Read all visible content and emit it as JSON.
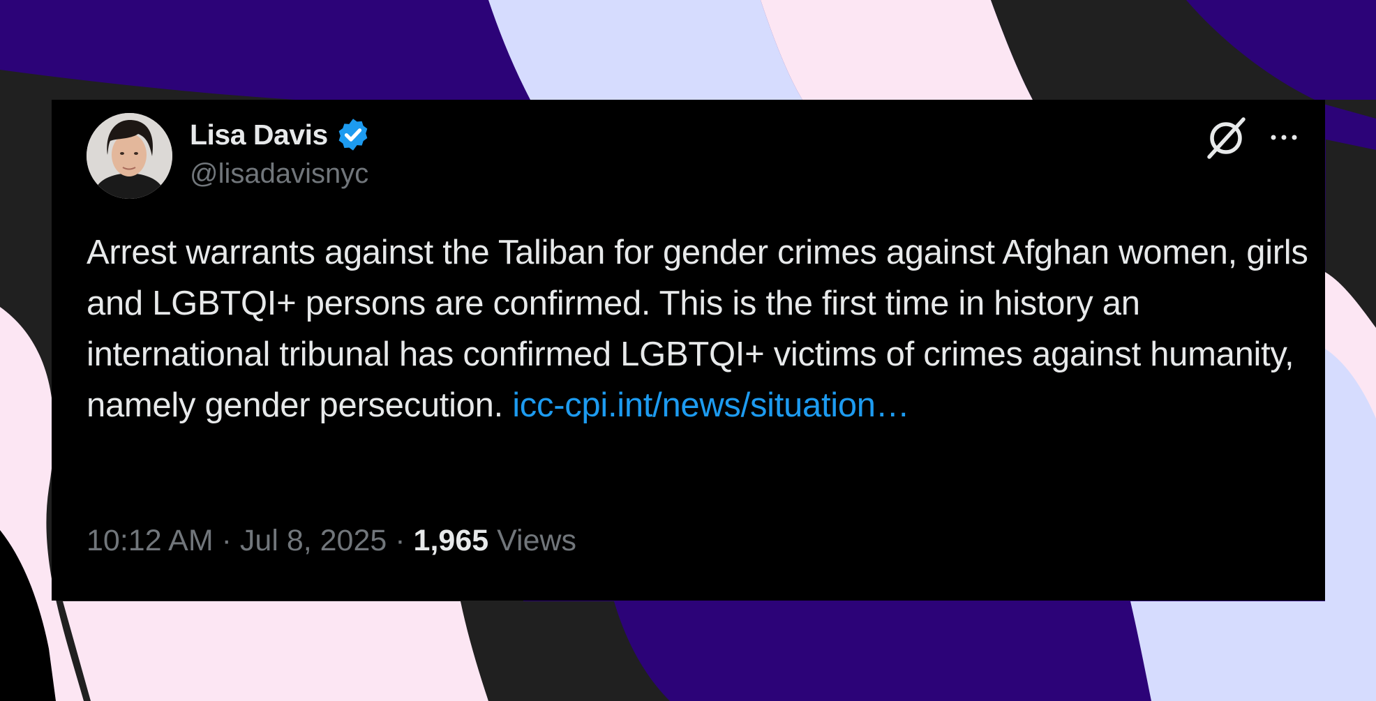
{
  "tweet": {
    "author": {
      "display_name": "Lisa Davis",
      "handle": "@lisadavisnyc",
      "verified": true
    },
    "text_main": "Arrest warrants against the Taliban for gender crimes against Afghan women, girls and LGBTQI+ persons are confirmed. This is the first time in history an international tribunal has confirmed LGBTQI+ victims of crimes against humanity, namely gender persecution. ",
    "link_text": "icc-cpi.int/news/situation…",
    "timestamp": "10:12 AM",
    "date": "Jul 8, 2025",
    "separator": "·",
    "views_count": "1,965",
    "views_label": "Views"
  },
  "icons": {
    "grok": "grok-icon",
    "more": "more-options-icon",
    "verified": "verified-badge-icon"
  },
  "colors": {
    "card_bg": "#000000",
    "text": "#e7e9ea",
    "muted": "#71767b",
    "link": "#1d9bf0",
    "bg_purple": "#2c0378",
    "bg_lavender": "#d6dcfe",
    "bg_pink": "#fce6f3",
    "bg_charcoal": "#202020"
  }
}
